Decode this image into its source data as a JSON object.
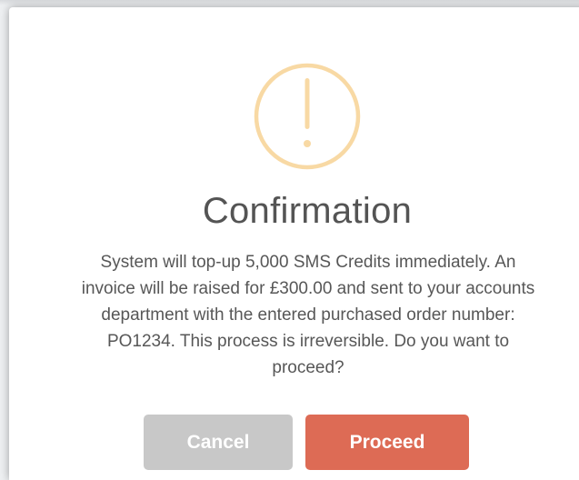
{
  "dialog": {
    "icon": "warning-exclamation-icon",
    "icon_color": "#f8d9a4",
    "title": "Confirmation",
    "message_lines": [
      "System will top-up 5,000 SMS Credits immediately. An",
      "invoice will be raised for £300.00 and sent to your accounts",
      "department with the entered purchased order number:",
      "PO1234. This process is irreversible. Do you want to",
      "proceed?"
    ],
    "buttons": {
      "cancel_label": "Cancel",
      "proceed_label": "Proceed"
    },
    "colors": {
      "cancel": "#c8c8c8",
      "proceed": "#dd6b55",
      "title": "#545454"
    }
  }
}
